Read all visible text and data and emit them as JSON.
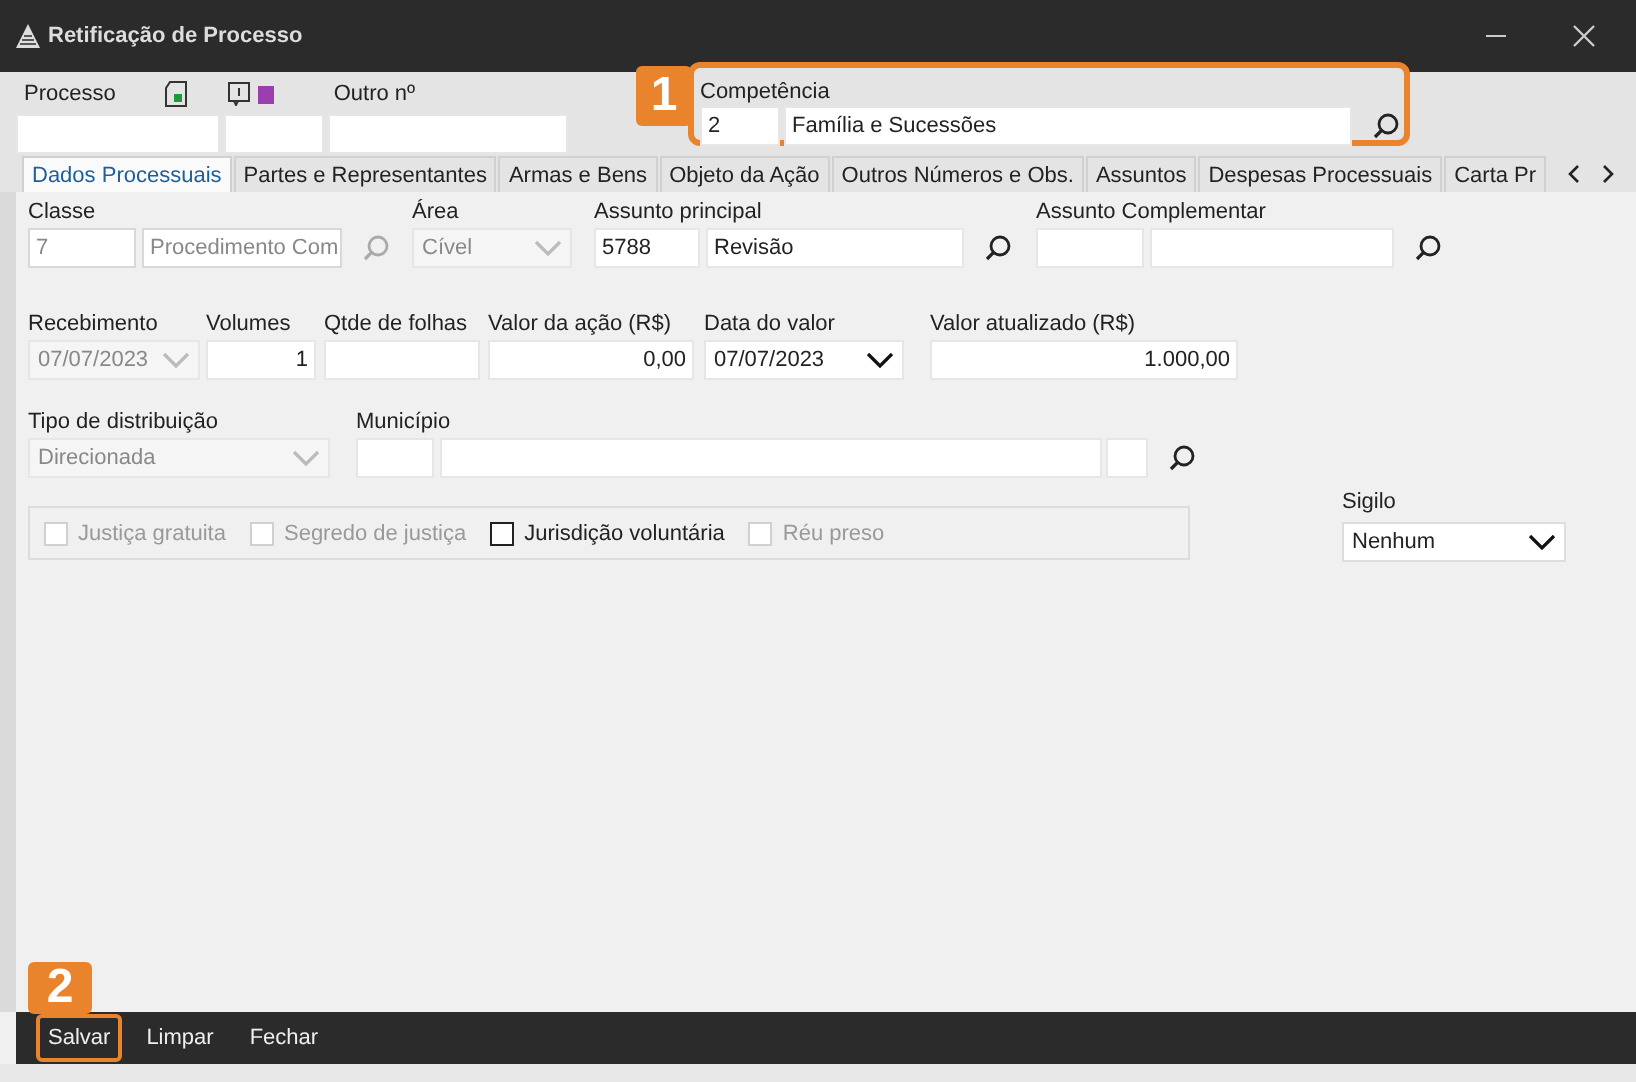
{
  "window": {
    "title": "Retificação de Processo"
  },
  "header": {
    "processo_label": "Processo",
    "outro_label": "Outro nº",
    "competencia": {
      "label": "Competência",
      "code": "2",
      "value": "Família e Sucessões"
    }
  },
  "tabs": [
    {
      "label": "Dados Processuais",
      "selected": true
    },
    {
      "label": "Partes e Representantes",
      "selected": false
    },
    {
      "label": "Armas e Bens",
      "selected": false
    },
    {
      "label": "Objeto da Ação",
      "selected": false
    },
    {
      "label": "Outros Números e Obs.",
      "selected": false
    },
    {
      "label": "Assuntos",
      "selected": false
    },
    {
      "label": "Despesas Processuais",
      "selected": false
    },
    {
      "label": "Carta Pr",
      "selected": false
    }
  ],
  "form_rows": [
    [
      {
        "kind": "lookup",
        "label": "Classe",
        "code": "7",
        "value": "Procedimento Com",
        "disabled": true
      },
      {
        "kind": "select",
        "label": "Área",
        "value": "Cível",
        "disabled": true
      },
      {
        "kind": "lookup",
        "label": "Assunto principal",
        "code": "5788",
        "value": "Revisão",
        "disabled": false
      },
      {
        "kind": "lookup",
        "label": "Assunto Complementar",
        "disabled": false
      }
    ],
    [
      {
        "kind": "select",
        "label": "Recebimento",
        "value": "07/07/2023",
        "disabled": true
      },
      {
        "kind": "number",
        "label": "Volumes",
        "value": "1",
        "disabled": false
      },
      {
        "kind": "number",
        "label": "Qtde de folhas",
        "disabled": false
      },
      {
        "kind": "number",
        "label": "Valor da ação (R$)",
        "value": "0,00",
        "disabled": false
      },
      {
        "kind": "select",
        "label": "Data do valor",
        "value": "07/07/2023",
        "disabled": false
      },
      {
        "kind": "number",
        "label": "Valor atualizado (R$)",
        "value": "1.000,00",
        "disabled": false
      }
    ],
    [
      {
        "kind": "select",
        "label": "Tipo de distribuição",
        "value": "Direcionada",
        "disabled": true
      },
      {
        "kind": "lookup",
        "label": "Município",
        "disabled": false,
        "extra_box": true
      }
    ]
  ],
  "checkboxes": [
    {
      "label": "Justiça gratuita",
      "checked": false,
      "disabled": true
    },
    {
      "label": "Segredo de justiça",
      "checked": false,
      "disabled": true
    },
    {
      "label": "Jurisdição voluntária",
      "checked": false,
      "disabled": false
    },
    {
      "label": "Réu preso",
      "checked": false,
      "disabled": true
    }
  ],
  "sigilo": {
    "label": "Sigilo",
    "value": "Nenhum"
  },
  "actions": [
    "Salvar",
    "Limpar",
    "Fechar"
  ],
  "annotations": [
    "1",
    "2"
  ]
}
